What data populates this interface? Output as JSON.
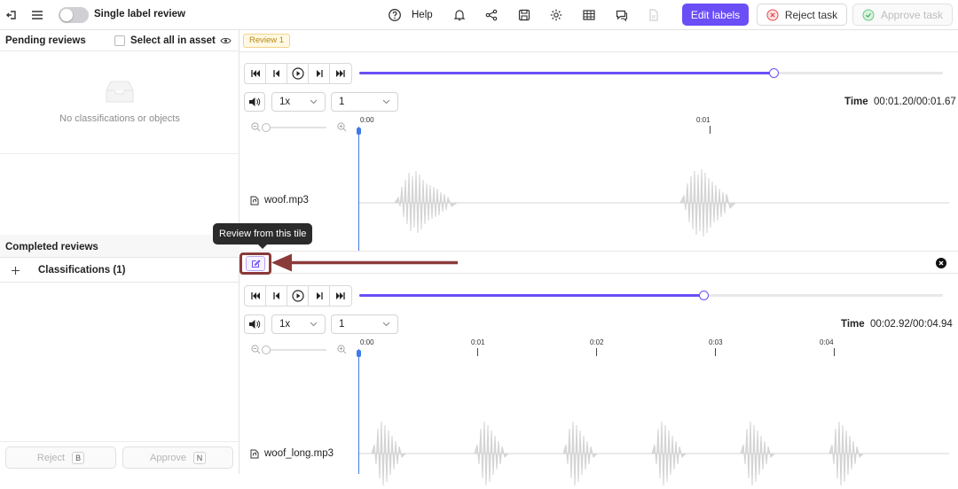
{
  "topbar": {
    "single_label_review": "Single label review",
    "help": "Help",
    "edit_labels": "Edit labels",
    "reject_task": "Reject task",
    "approve_task": "Approve task"
  },
  "sidebar": {
    "pending_title": "Pending reviews",
    "select_all": "Select all in asset",
    "empty_text": "No classifications or objects",
    "completed_title": "Completed reviews",
    "classifications": "Classifications (1)",
    "reject": "Reject",
    "reject_key": "B",
    "approve": "Approve",
    "approve_key": "N"
  },
  "main": {
    "review_tag": "Review 1",
    "tooltip": "Review from this tile",
    "tiles": [
      {
        "file": "woof.mp3",
        "speed": "1x",
        "channel": "1",
        "time_label": "Time",
        "time": "00:01.20/00:01.67",
        "progress": 0.71,
        "ticks": [
          "0:00",
          "0:01"
        ]
      },
      {
        "file": "woof_long.mp3",
        "speed": "1x",
        "channel": "1",
        "time_label": "Time",
        "time": "00:02.92/00:04.94",
        "progress": 0.59,
        "ticks": [
          "0:00",
          "0:01",
          "0:02",
          "0:03",
          "0:04"
        ]
      }
    ]
  },
  "colors": {
    "accent": "#6b4ef6",
    "playhead": "#3e7be9",
    "annotation_arrow": "#8b3a3a",
    "waveform": "#d6d6d6"
  }
}
